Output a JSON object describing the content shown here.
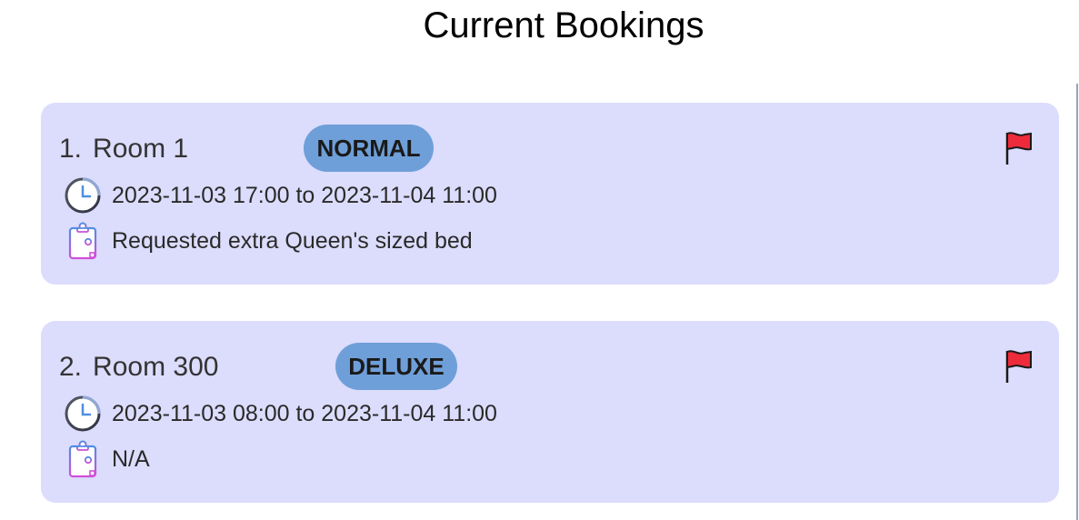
{
  "page": {
    "title": "Current Bookings"
  },
  "bookings": [
    {
      "index": "1.",
      "room": "Room 1",
      "room_type": "NORMAL",
      "time_range": "2023-11-03 17:00 to 2023-11-04 11:00",
      "remark": "Requested extra Queen's sized bed",
      "flag_color": "#ee2b3b"
    },
    {
      "index": "2.",
      "room": "Room 300",
      "room_type": "DELUXE",
      "time_range": "2023-11-03 08:00 to 2023-11-04 11:00",
      "remark": "N/A",
      "flag_color": "#ee2b3b"
    }
  ],
  "icons": {
    "time": "clock-icon",
    "remark": "clipboard-icon",
    "flag": "flag-icon"
  },
  "colors": {
    "card_background": "#dcdcfd",
    "badge_background": "#6f9fd8",
    "flag_red": "#ee2b3b"
  }
}
